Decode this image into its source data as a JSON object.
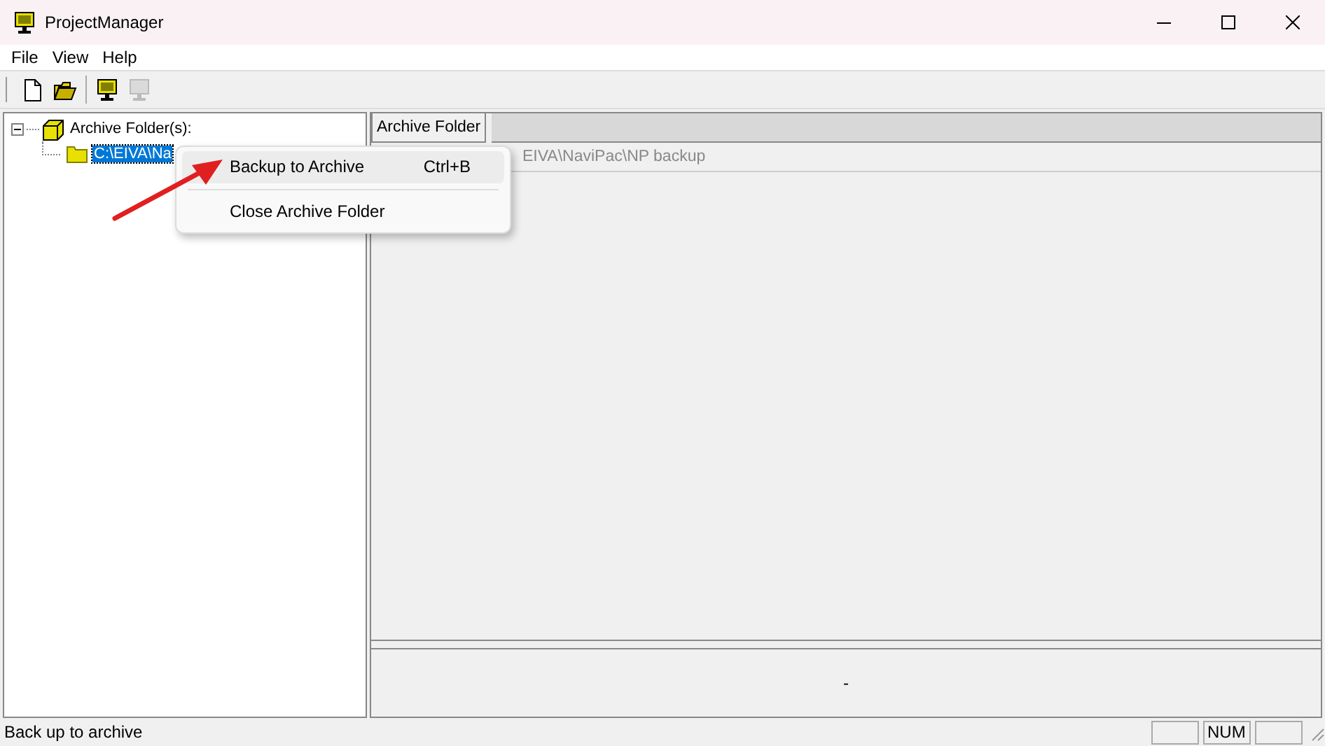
{
  "window": {
    "title": "ProjectManager"
  },
  "menu_bar": [
    "File",
    "View",
    "Help"
  ],
  "toolbar": [
    {
      "kind": "new",
      "disabled": false
    },
    {
      "kind": "open",
      "disabled": false
    },
    {
      "kind": "monitor",
      "disabled": false
    },
    {
      "kind": "monitor",
      "disabled": true
    }
  ],
  "tree": [
    {
      "label": "Archive Folder(s):",
      "expanded": true,
      "selected": false,
      "children": [
        {
          "label": "C:\\EIVA\\Na",
          "selected": true
        }
      ]
    }
  ],
  "list": {
    "columns": [
      "Archive Folder"
    ],
    "rows": [
      [
        "EIVA\\NaviPac\\NP backup"
      ]
    ]
  },
  "detail": "-",
  "context_menu": [
    {
      "label": "Backup to Archive",
      "shortcut": "Ctrl+B",
      "selected": true
    },
    {
      "label": "Close Archive Folder",
      "selected": false
    }
  ],
  "status_bar": {
    "text": "Back up to archive",
    "panes": [
      {
        "kind": "blank"
      },
      {
        "kind": "text",
        "text": "NUM"
      },
      {
        "kind": "blank"
      }
    ]
  }
}
